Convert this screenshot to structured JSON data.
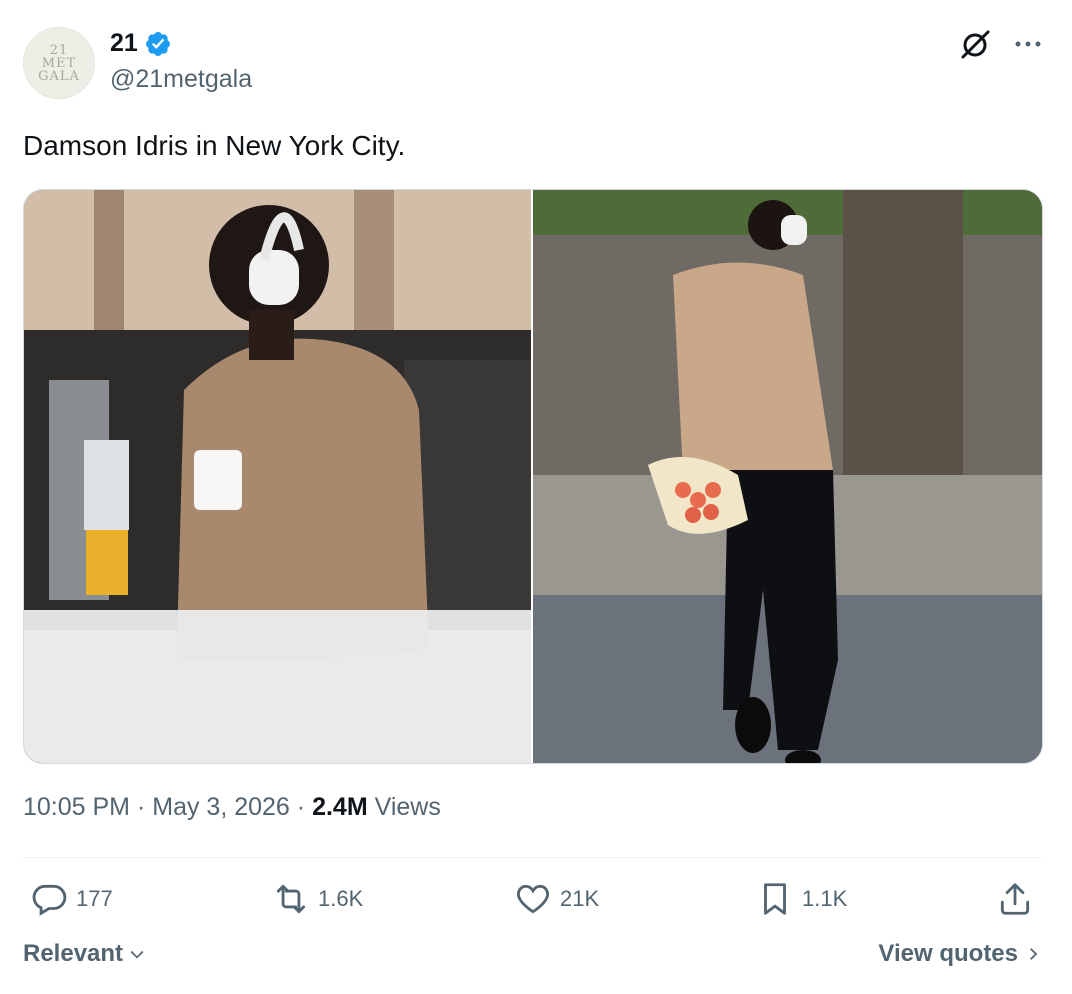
{
  "author": {
    "avatar_lines": [
      "21",
      "MET",
      "GALA"
    ],
    "display_name": "21",
    "verified": true,
    "handle": "@21metgala"
  },
  "icons": {
    "grok": "grok-icon",
    "more": "more-icon",
    "verified": "verified-badge-icon"
  },
  "tweet": {
    "text": "Damson Idris in New York City.",
    "time": "10:05 PM",
    "date": "May 3, 2026",
    "views_count": "2.4M",
    "views_label": "Views",
    "separator": "·"
  },
  "media": [
    {
      "name": "photo-left",
      "subject": "man in tan sweater with headphones holding coffee cup"
    },
    {
      "name": "photo-right",
      "subject": "man in tan sweater walking with bouquet of tulips"
    }
  ],
  "actions": {
    "replies": "177",
    "reposts": "1.6K",
    "likes": "21K",
    "bookmarks": "1.1K"
  },
  "footer": {
    "sort_label": "Relevant",
    "view_quotes_label": "View quotes"
  },
  "colors": {
    "verified": "#1d9bf0",
    "secondary_text": "#536471",
    "text": "#0f1419"
  }
}
